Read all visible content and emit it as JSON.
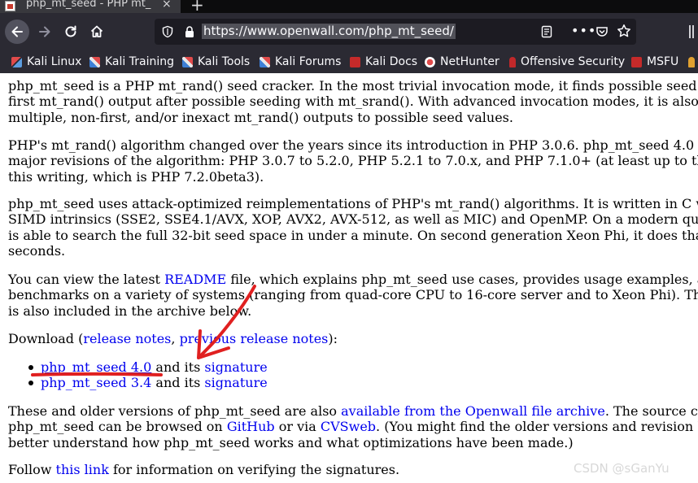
{
  "tab": {
    "title": "php_mt_seed - PHP mt_",
    "close": "×",
    "new_tab": "+"
  },
  "urlbar": {
    "url": "https://www.openwall.com/php_mt_seed/",
    "more": "•••"
  },
  "bookmarks": [
    {
      "label": "Kali Linux",
      "icon": "kali-dragon-icon"
    },
    {
      "label": "Kali Training",
      "icon": "kali-icon"
    },
    {
      "label": "Kali Tools",
      "icon": "kali-icon"
    },
    {
      "label": "Kali Forums",
      "icon": "kali-icon"
    },
    {
      "label": "Kali Docs",
      "icon": "kali-docs-icon"
    },
    {
      "label": "NetHunter",
      "icon": "nethunter-icon"
    },
    {
      "label": "Offensive Security",
      "icon": "offsec-icon"
    },
    {
      "label": "MSFU",
      "icon": "msfu-icon"
    }
  ],
  "content": {
    "p1": [
      "php_mt_seed is a PHP mt_rand() seed cracker. In the most trivial invocation mode, it finds possible seed",
      "first mt_rand() output after possible seeding with mt_srand(). With advanced invocation modes, it is also",
      "multiple, non-first, and/or inexact mt_rand() outputs to possible seed values."
    ],
    "p2": [
      "PHP's mt_rand() algorithm changed over the years since its introduction in PHP 3.0.6. php_mt_seed 4.0",
      "major revisions of the algorithm: PHP 3.0.7 to 5.2.0, PHP 5.2.1 to 7.0.x, and PHP 7.1.0+ (at least up to th",
      "this writing, which is PHP 7.2.0beta3)."
    ],
    "p3": [
      "php_mt_seed uses attack-optimized reimplementations of PHP's mt_rand() algorithms. It is written in C wi",
      "SIMD intrinsics (SSE2, SSE4.1/AVX, XOP, AVX2, AVX-512, as well as MIC) and OpenMP. On a modern qua",
      "is able to search the full 32-bit seed space in under a minute. On second generation Xeon Phi, it does that",
      "seconds."
    ],
    "p4": {
      "before": "You can view the latest ",
      "link": "README",
      "after": " file, which explains php_mt_seed use cases, provides usage examples, a",
      "line2": "benchmarks on a variety of systems (ranging from quad-core CPU to 16-core server and to Xeon Phi). Th",
      "line3": "is also included in the archive below."
    },
    "p5": {
      "before": "Download (",
      "link1": "release notes",
      "sep": ", ",
      "link2": "previous release notes",
      "after": "):"
    },
    "downloads": [
      {
        "link": "php_mt_seed 4.0",
        "mid": " and its ",
        "sig": "signature"
      },
      {
        "link": "php_mt_seed 3.4",
        "mid": " and its ",
        "sig": "signature"
      }
    ],
    "p6": {
      "before": "These and older versions of php_mt_seed are also ",
      "link1": "available from the Openwall file archive",
      "after1": ". The source co",
      "l2_before": "php_mt_seed can be browsed on ",
      "link2": "GitHub",
      "l2_mid": " or via ",
      "link3": "CVSweb",
      "l2_after": ". (You might find the older versions and revision h",
      "line3": "better understand how php_mt_seed works and what optimizations have been made.)"
    },
    "p7": {
      "before": "Follow ",
      "link": "this link",
      "after": " for information on verifying the signatures."
    }
  },
  "watermark": "CSDN @sGanYu",
  "colors": {
    "link": "#0000ee",
    "annotation": "#e02020",
    "toolbar": "#2b2a33",
    "tabbar": "#0c0c0d"
  }
}
